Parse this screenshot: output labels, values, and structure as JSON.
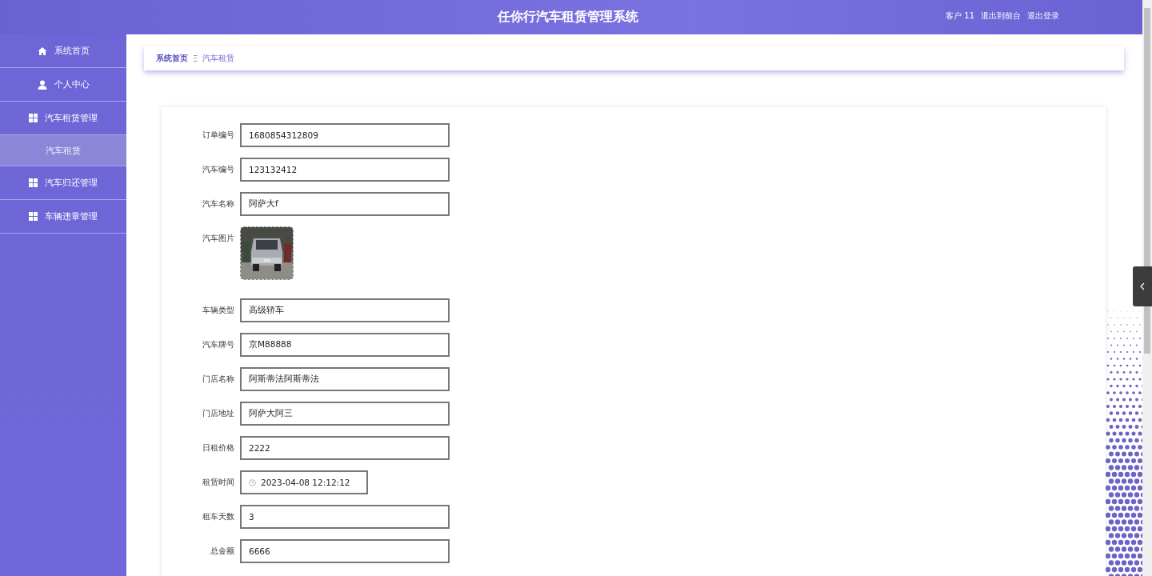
{
  "header": {
    "title": "任你行汽车租赁管理系统",
    "user": "客户 11",
    "links": [
      "退出到前台",
      "退出登录"
    ]
  },
  "sidebar": {
    "items": [
      {
        "kind": "home",
        "label": "系统首页",
        "selected": false
      },
      {
        "kind": "user",
        "label": "个人中心",
        "selected": false
      },
      {
        "kind": "grid",
        "label": "汽车租赁管理",
        "selected": false
      },
      {
        "kind": "sub",
        "label": "汽车租赁",
        "selected": true
      },
      {
        "kind": "grid",
        "label": "汽车归还管理",
        "selected": false
      },
      {
        "kind": "grid",
        "label": "车辆违章管理",
        "selected": false
      }
    ]
  },
  "breadcrumb": {
    "items": [
      "系统首页",
      "汽车租赁"
    ],
    "separator": "Ξ"
  },
  "form": {
    "fields": [
      {
        "kind": "text",
        "label": "订单编号",
        "value": "1680854312809"
      },
      {
        "kind": "text",
        "label": "汽车编号",
        "value": "123132412"
      },
      {
        "kind": "text",
        "label": "汽车名称",
        "value": "阿萨大f"
      },
      {
        "label": "汽车图片"
      },
      {
        "kind": "text",
        "label": "车辆类型",
        "value": "高级轿车"
      },
      {
        "kind": "text",
        "label": "汽车牌号",
        "value": "京M88888"
      },
      {
        "kind": "text",
        "label": "门店名称",
        "value": "阿斯蒂法阿斯蒂法"
      },
      {
        "kind": "text",
        "label": "门店地址",
        "value": "阿萨大阿三"
      },
      {
        "kind": "text",
        "label": "日租价格",
        "value": "2222"
      },
      {
        "kind": "datetime",
        "label": "租赁时间",
        "value": "2023-04-08 12:12:12"
      },
      {
        "kind": "text",
        "label": "租车天数",
        "value": "3"
      },
      {
        "kind": "text",
        "label": "总金额",
        "value": "6666"
      }
    ]
  }
}
